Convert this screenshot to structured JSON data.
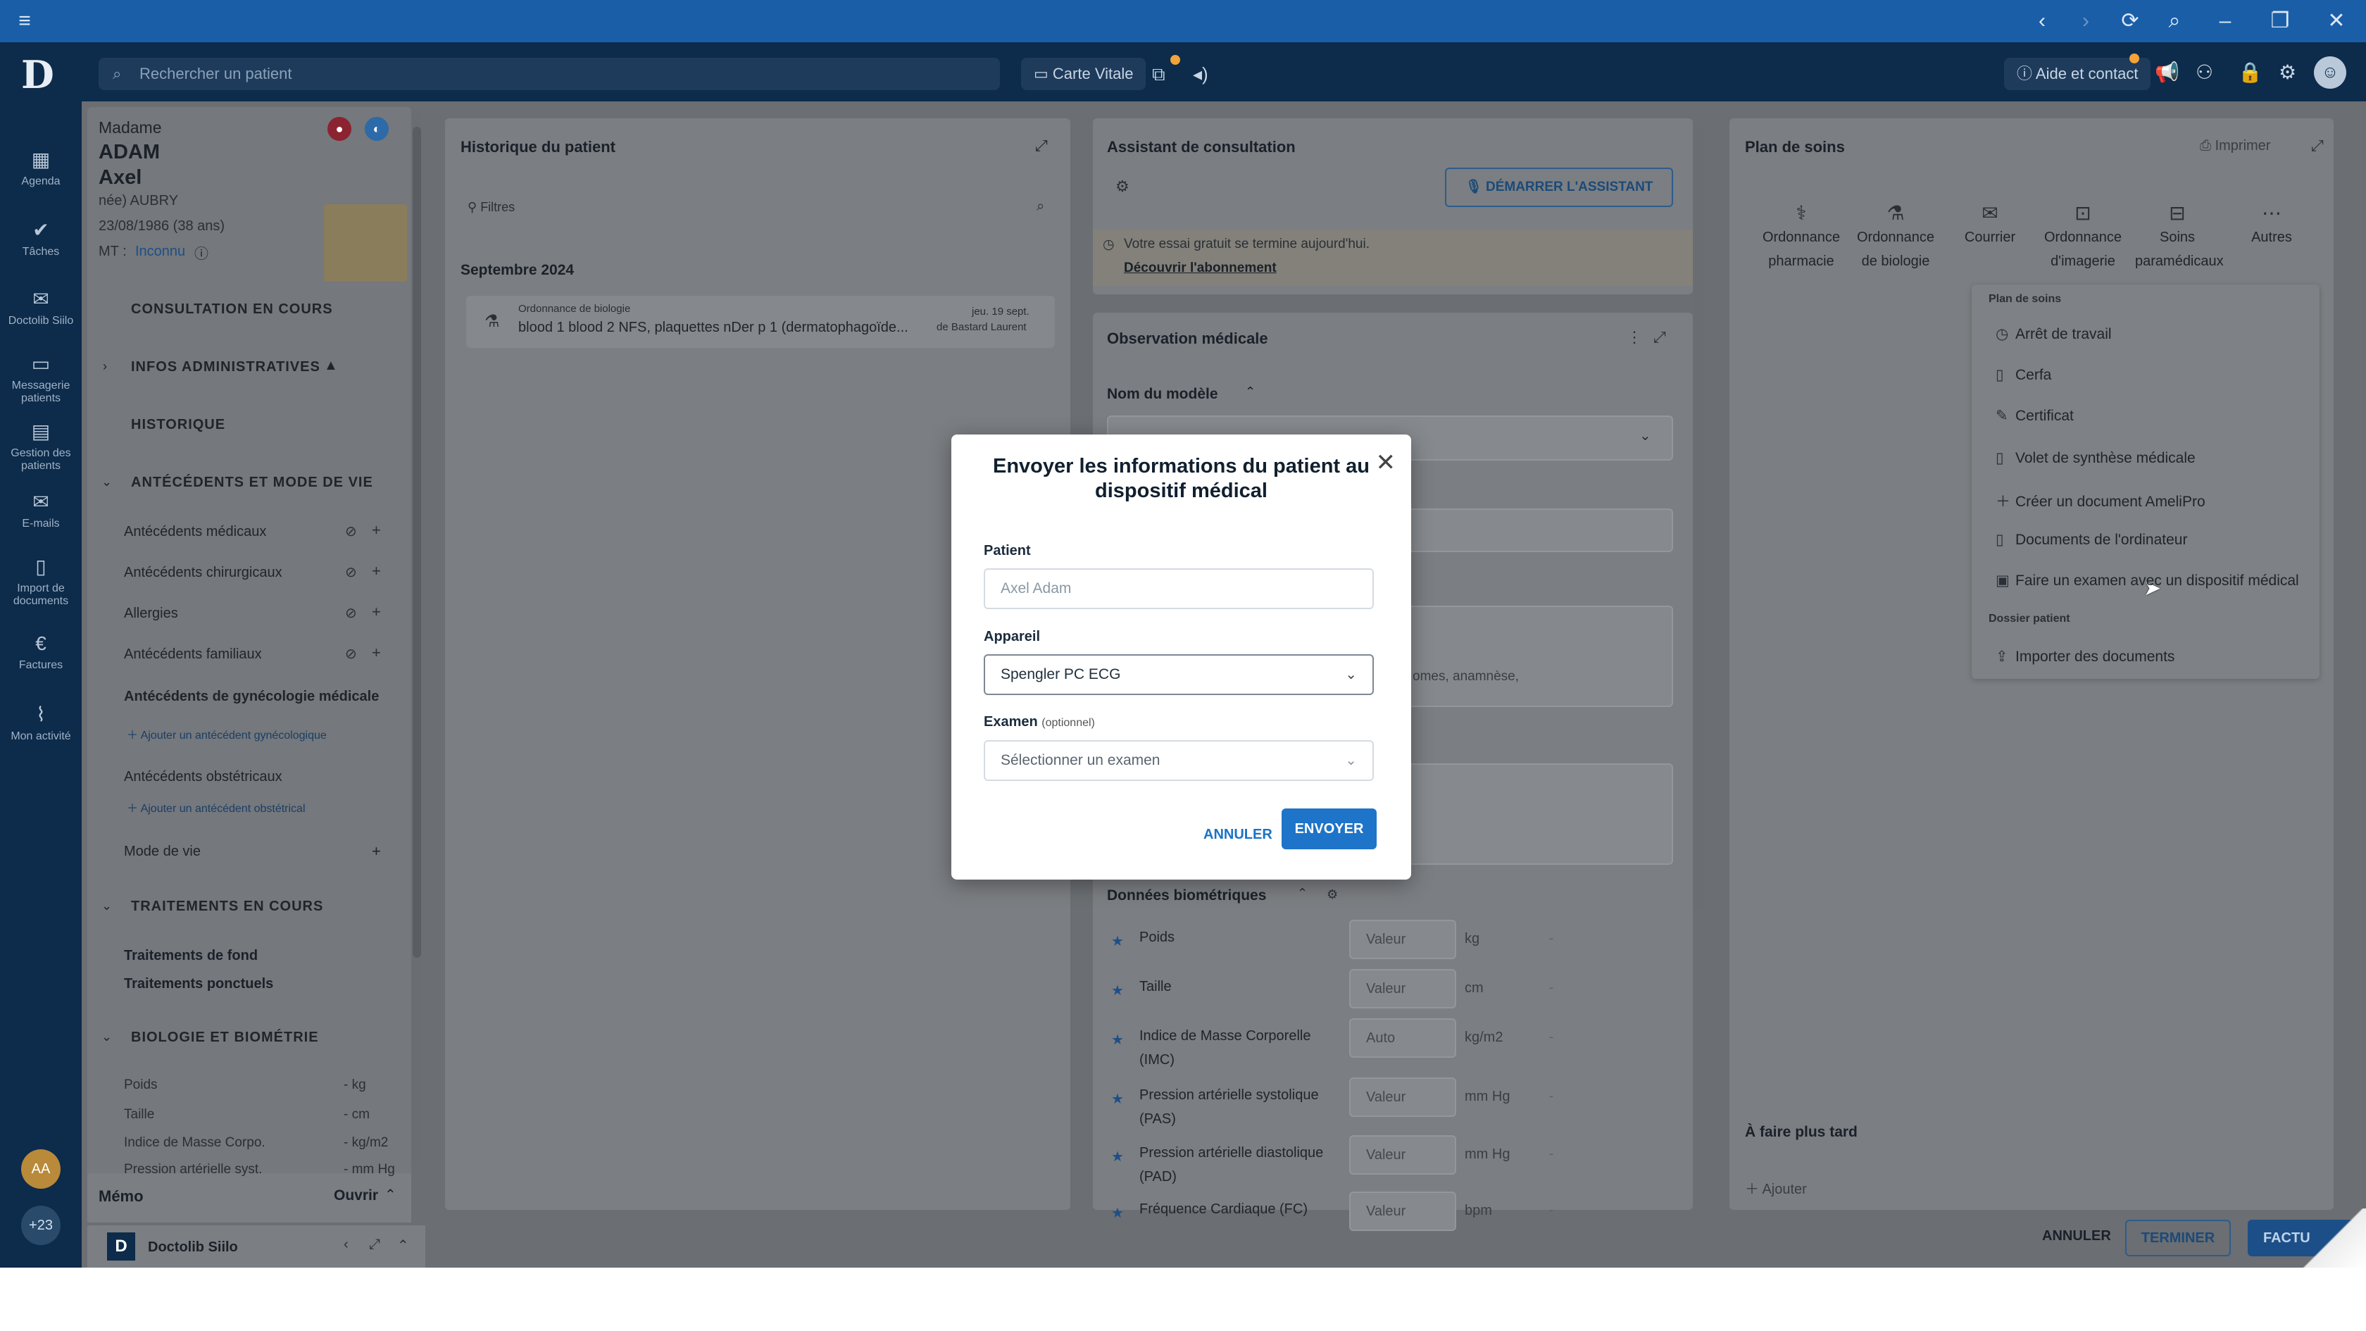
{
  "search": {
    "placeholder": "Rechercher un patient"
  },
  "appbar": {
    "carte_vitale": "Carte Vitale",
    "help": "Aide et contact"
  },
  "nav": [
    {
      "label": "Agenda",
      "icon": "calendar-icon"
    },
    {
      "label": "Tâches",
      "icon": "check-circle-icon"
    },
    {
      "label": "Doctolib Siilo",
      "icon": "chat-icon"
    },
    {
      "label": "Messagerie patients",
      "icon": "message-icon"
    },
    {
      "label": "Gestion des patients",
      "icon": "folder-icon"
    },
    {
      "label": "E-mails",
      "icon": "mail-icon"
    },
    {
      "label": "Import de documents",
      "icon": "document-icon"
    },
    {
      "label": "Factures",
      "icon": "euro-icon"
    },
    {
      "label": "Mon activité",
      "icon": "chart-icon"
    }
  ],
  "nav_bottom": {
    "avatar": "AA",
    "counter": "+23"
  },
  "patient": {
    "civility": "Madame",
    "last_name": "ADAM",
    "first_name": "Axel",
    "birth_name": "née) AUBRY",
    "dob": "23/08/1986 (38 ans)",
    "mt_label": "MT :",
    "mt_value": "Inconnu"
  },
  "sidebar": {
    "consultation": "CONSULTATION EN COURS",
    "infos": "INFOS ADMINISTRATIVES",
    "historique": "HISTORIQUE",
    "antecedents": "ANTÉCÉDENTS ET MODE DE VIE",
    "antecedent_items": [
      "Antécédents médicaux",
      "Antécédents chirurgicaux",
      "Allergies",
      "Antécédents familiaux"
    ],
    "gyneco": "Antécédents de gynécologie médicale",
    "add_gyneco": "Ajouter un antécédent gynécologique",
    "obstetrical": "Antécédents obstétricaux",
    "add_obstetrical": "Ajouter un antécédent obstétrical",
    "mode_vie": "Mode de vie",
    "traitements": "TRAITEMENTS EN COURS",
    "traitement_fond": "Traitements de fond",
    "traitement_ponctuel": "Traitements ponctuels",
    "biologie": "BIOLOGIE ET BIOMÉTRIE",
    "bio_rows": [
      {
        "label": "Poids",
        "value": "- kg"
      },
      {
        "label": "Taille",
        "value": "- cm"
      },
      {
        "label": "Indice de Masse Corpo.",
        "value": "- kg/m2"
      },
      {
        "label": "Pression artérielle syst.",
        "value": "- mm Hg"
      }
    ],
    "memo": "Mémo",
    "memo_open": "Ouvrir",
    "siilo": "Doctolib Siilo"
  },
  "history": {
    "title": "Historique du patient",
    "filters": "Filtres",
    "month": "Septembre 2024",
    "entry_type": "Ordonnance de biologie",
    "entry_text": "blood 1 blood 2 NFS, plaquettes nDer p 1 (dermatophagoïde...",
    "entry_date": "jeu. 19 sept.",
    "entry_author": "de Bastard Laurent"
  },
  "assistant": {
    "title": "Assistant de consultation",
    "start": "DÉMARRER L'ASSISTANT",
    "trial": "Votre essai gratuit se termine aujourd'hui.",
    "discover": "Découvrir l'abonnement"
  },
  "observation": {
    "title": "Observation médicale",
    "model_name": "Nom du modèle",
    "partial_text": "omes, anamnèse,"
  },
  "biometrics": {
    "title": "Données biométriques",
    "placeholder": "Valeur",
    "auto": "Auto",
    "rows": [
      {
        "label": "Poids",
        "unit": "kg"
      },
      {
        "label": "Taille",
        "unit": "cm"
      },
      {
        "label": "Indice de Masse Corporelle (IMC)",
        "unit": "kg/m2"
      },
      {
        "label": "Pression artérielle systolique (PAS)",
        "unit": "mm Hg"
      },
      {
        "label": "Pression artérielle diastolique (PAD)",
        "unit": "mm Hg"
      },
      {
        "label": "Fréquence Cardiaque (FC)",
        "unit": "bpm"
      }
    ]
  },
  "care_plan": {
    "title": "Plan de soins",
    "print": "Imprimer",
    "tools": [
      {
        "l1": "Ordonnance",
        "l2": "pharmacie",
        "icon": "pills-icon"
      },
      {
        "l1": "Ordonnance",
        "l2": "de biologie",
        "icon": "flask-icon"
      },
      {
        "l1": "Courrier",
        "l2": "",
        "icon": "mail-icon"
      },
      {
        "l1": "Ordonnance",
        "l2": "d'imagerie",
        "icon": "scan-icon"
      },
      {
        "l1": "Soins",
        "l2": "paramédicaux",
        "icon": "bandage-icon"
      },
      {
        "l1": "Autres",
        "l2": "",
        "icon": "more-icon"
      }
    ],
    "menu_section1": "Plan de soins",
    "menu_items": [
      {
        "label": "Arrêt de travail",
        "icon": "clock-icon"
      },
      {
        "label": "Cerfa",
        "icon": "file-icon"
      },
      {
        "label": "Certificat",
        "icon": "certificate-icon"
      },
      {
        "label": "Volet de synthèse médicale",
        "icon": "document-icon"
      },
      {
        "label": "Créer un document AmeliPro",
        "icon": "plus-icon"
      },
      {
        "label": "Documents de l'ordinateur",
        "icon": "document-icon"
      },
      {
        "label": "Faire un examen avec un dispositif médical",
        "icon": "device-icon"
      }
    ],
    "menu_section2": "Dossier patient",
    "menu_items2": [
      {
        "label": "Importer des documents",
        "icon": "import-icon"
      }
    ],
    "later": "À faire plus tard",
    "add": "Ajouter"
  },
  "footer": {
    "cancel": "ANNULER",
    "finish": "TERMINER",
    "invoice": "FACTU"
  },
  "modal": {
    "title": "Envoyer les informations du patient au dispositif médical",
    "patient_label": "Patient",
    "patient_value": "Axel Adam",
    "device_label": "Appareil",
    "device_value": "Spengler PC ECG",
    "exam_label": "Examen",
    "exam_optional": "(optionnel)",
    "exam_placeholder": "Sélectionner un examen",
    "cancel": "ANNULER",
    "send": "ENVOYER"
  }
}
